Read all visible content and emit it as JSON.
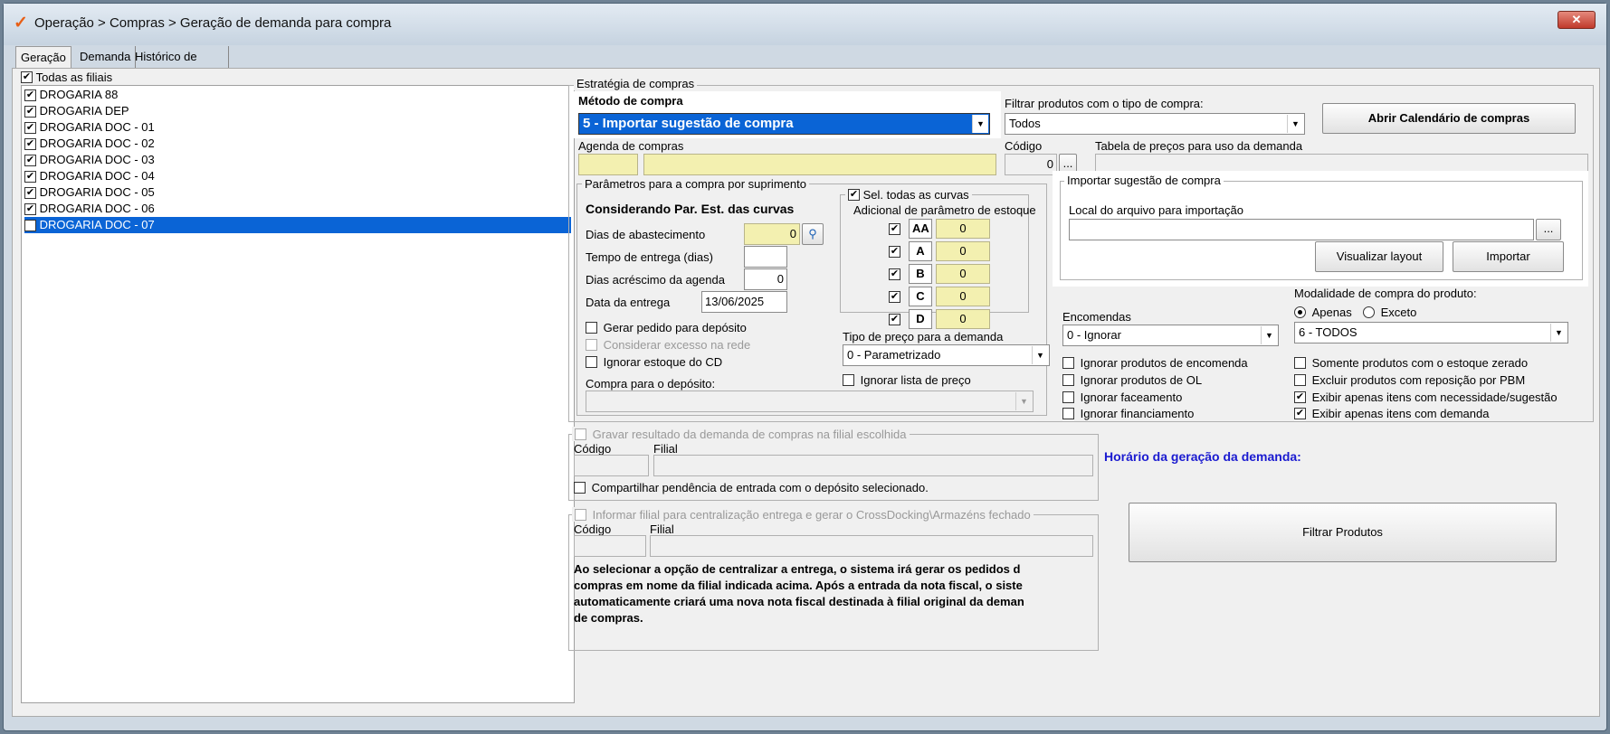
{
  "window": {
    "title": "Operação > Compras > Geração de demanda para compra",
    "close_label": "✕"
  },
  "tabs": [
    "Geração",
    "Demanda",
    "Histórico de demandas salvas temporariamente"
  ],
  "filiais": {
    "all_label": "Todas as filiais",
    "items": [
      "DROGARIA 88",
      "DROGARIA DEP",
      "DROGARIA DOC - 01",
      "DROGARIA DOC - 02",
      "DROGARIA DOC - 03",
      "DROGARIA DOC - 04",
      "DROGARIA DOC - 05",
      "DROGARIA DOC - 06",
      "DROGARIA DOC - 07"
    ]
  },
  "estrategia": {
    "group_title": "Estratégia de compras",
    "metodo_label": "Método de compra",
    "metodo_value": "5 - Importar sugestão de compra",
    "filtrar_label": "Filtrar produtos com o tipo de compra:",
    "filtrar_value": "Todos",
    "calendario_button": "Abrir Calendário de compras",
    "agenda_label": "Agenda de compras",
    "codigo_label": "Código",
    "codigo_value": "0",
    "tabela_label": "Tabela de preços para uso da demanda",
    "ellipsis": "..."
  },
  "parametros": {
    "group_title": "Parâmetros para a compra por suprimento",
    "heading": "Considerando Par. Est. das curvas",
    "dias_abastecimento_label": "Dias de abastecimento",
    "dias_abastecimento_value": "0",
    "tempo_entrega_label": "Tempo de entrega (dias)",
    "dias_acrescimo_label": "Dias acréscimo da agenda",
    "dias_acrescimo_value": "0",
    "data_entrega_label": "Data da entrega",
    "data_entrega_value": "13/06/2025",
    "gerar_pedido_label": "Gerar pedido para depósito",
    "considerar_excesso_label": "Considerar excesso na rede",
    "ignorar_estoque_cd_label": "Ignorar estoque do CD",
    "compra_deposito_label": "Compra para o depósito:"
  },
  "curvas": {
    "sel_todas_label": "Sel. todas as curvas",
    "adicional_label": "Adicional de parâmetro de estoque",
    "items": [
      {
        "name": "AA",
        "value": "0"
      },
      {
        "name": "A",
        "value": "0"
      },
      {
        "name": "B",
        "value": "0"
      },
      {
        "name": "C",
        "value": "0"
      },
      {
        "name": "D",
        "value": "0"
      }
    ],
    "tipo_preco_label": "Tipo de preço para a demanda",
    "tipo_preco_value": "0 - Parametrizado",
    "ignorar_lista_label": "Ignorar lista de preço"
  },
  "importar": {
    "group_title": "Importar sugestão de compra",
    "local_label": "Local do arquivo para importação",
    "ellipsis": "...",
    "visualizar_button": "Visualizar layout",
    "importar_button": "Importar"
  },
  "encomendas": {
    "label": "Encomendas",
    "value": "0 - Ignorar",
    "checks": [
      "Ignorar produtos de encomenda",
      "Ignorar produtos de OL",
      "Ignorar faceamento",
      "Ignorar financiamento"
    ]
  },
  "modalidade": {
    "label": "Modalidade de compra do produto:",
    "apenas_label": "Apenas",
    "exceto_label": "Exceto",
    "value": "6 - TODOS",
    "checks": [
      {
        "label": "Somente produtos com o estoque zerado",
        "checked": false
      },
      {
        "label": "Excluir produtos com reposição por PBM",
        "checked": false
      },
      {
        "label": "Exibir apenas itens com necessidade/sugestão",
        "checked": true
      },
      {
        "label": "Exibir apenas itens com demanda",
        "checked": true
      }
    ]
  },
  "gravar": {
    "group_title": "Gravar resultado da demanda de compras na filial escolhida",
    "codigo_label": "Código",
    "filial_label": "Filial",
    "compartilhar_label": "Compartilhar pendência de entrada com o depósito selecionado."
  },
  "centralizar": {
    "group_title": "Informar filial para centralização entrega e gerar o CrossDocking\\Armazéns fechado",
    "codigo_label": "Código",
    "filial_label": "Filial",
    "info_lines": [
      "Ao selecionar a opção de centralizar a entrega, o sistema irá gerar os pedidos d",
      "compras em nome da filial indicada acima. Após a entrada da nota fiscal, o siste",
      "automaticamente criará uma nova nota fiscal destinada à filial original da deman",
      "de compras."
    ]
  },
  "horario_label": "Horário da geração da demanda:",
  "filtrar_produtos_button": "Filtrar Produtos"
}
